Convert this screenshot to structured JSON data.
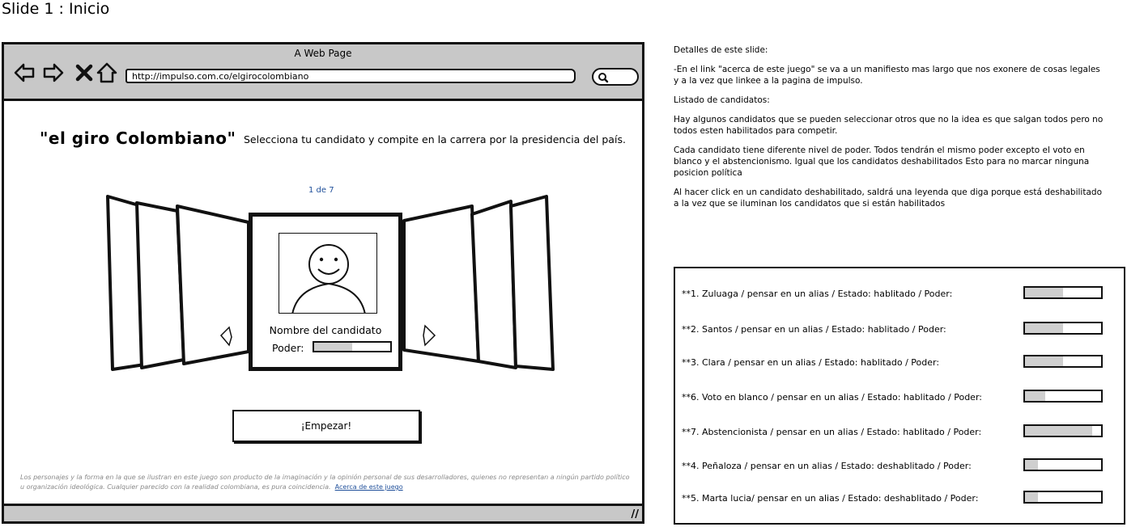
{
  "slide_title": "Slide 1 : Inicio",
  "browser": {
    "window_title": "A Web Page",
    "url": "http://impulso.com.co/elgirocolombiano",
    "nav_icons": [
      "back-arrow-icon",
      "forward-arrow-icon",
      "stop-icon",
      "home-icon"
    ],
    "search_icon": "search-icon"
  },
  "page": {
    "game_title": "\"el giro Colombiano\"",
    "subtitle": "Selecciona tu candidato y compite en la carrera por la presidencia del país.",
    "page_counter": "1 de 7",
    "card": {
      "name": "Nombre del candidato",
      "poder_label": "Poder:",
      "poder_level": 0.5
    },
    "start_button": "¡Empezar!",
    "disclaimer": "Los personajes y la forma en la que se ilustran en este juego son producto de la imaginación y la opinión personal de sus desarrolladores, quienes no representan a ningún partido político u organización ideológica. Cualquier parecido con la realidad colombiana, es pura coincidencia.",
    "about_link": "Acerca de este juego"
  },
  "notes": {
    "heading": "Detalles de este slide:",
    "paragraphs": [
      " -En el link \"acerca de este juego\" se va a un manifiesto mas largo que nos exonere de cosas  legales y a la vez que linkee a la pagina de impulso.",
      "Listado de candidatos:",
      "Hay algunos candidatos que se pueden seleccionar otros que no la idea es que salgan todos pero no todos esten habilitados para competir.",
      "Cada candidato tiene diferente nivel de poder. Todos tendrán el mismo poder excepto el voto en blanco y el abstencionismo. Igual que los candidatos deshabilitados Esto para no marcar ninguna posicion política",
      "Al hacer click en un candidato deshabilitado, saldrá una leyenda que diga porque está deshabilitado a la vez que se iluminan los candidatos que si están habilitados"
    ]
  },
  "candidates": [
    {
      "label": "**1. Zuluaga / pensar en un alias / Estado: hablitado / Poder:",
      "poder": 0.5
    },
    {
      "label": "**2. Santos / pensar en un alias / Estado: hablitado / Poder:",
      "poder": 0.5
    },
    {
      "label": "**3. Clara / pensar en un alias / Estado: hablitado / Poder:",
      "poder": 0.5
    },
    {
      "label": "**6. Voto en blanco / pensar en un alias / Estado: hablitado / Poder:",
      "poder": 0.27
    },
    {
      "label": "**7. Abstencionista / pensar en un alias / Estado: hablitado / Poder:",
      "poder": 0.88
    },
    {
      "label": "**4. Peñaloza / pensar en un alias / Estado: deshablitado / Poder:",
      "poder": 0.17
    },
    {
      "label": "**5. Marta lucia/ pensar en un alias / Estado: deshablitado / Poder:",
      "poder": 0.17
    }
  ]
}
